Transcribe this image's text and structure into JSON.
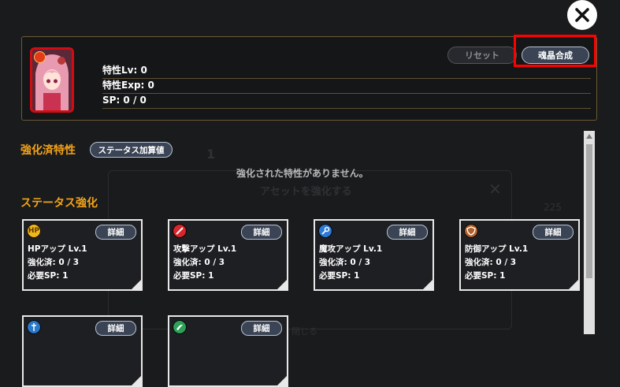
{
  "background_ghost": {
    "title": "アセットを強化する",
    "value": "225",
    "close_label": "閉じる",
    "count": "1"
  },
  "header": {
    "trait_level": "特性Lv: 0",
    "trait_exp": "特性Exp: 0",
    "sp": "SP: 0 / 0",
    "reset_label": "リセット",
    "synth_label": "魂晶合成"
  },
  "enhanced": {
    "title": "強化済特性",
    "status_button": "ステータス加算値",
    "empty_message": "強化された特性がありません。"
  },
  "status_section": {
    "title": "ステータス強化",
    "detail_label": "詳細",
    "cards": [
      {
        "icon_name": "hp-icon",
        "icon_text": "HP",
        "name": "HPアップ Lv.1",
        "level": "強化済: 0 / 3",
        "sp": "必要SP: 1",
        "color": "#f2b51a"
      },
      {
        "icon_name": "sword-icon",
        "icon_text": "",
        "name": "攻撃アップ Lv.1",
        "level": "強化済: 0 / 3",
        "sp": "必要SP: 1",
        "color": "#d8262d"
      },
      {
        "icon_name": "magic-staff-icon",
        "icon_text": "",
        "name": "魔攻アップ Lv.1",
        "level": "強化済: 0 / 3",
        "sp": "必要SP: 1",
        "color": "#2d79d6"
      },
      {
        "icon_name": "shield-icon",
        "icon_text": "",
        "name": "防御アップ Lv.1",
        "level": "強化済: 0 / 3",
        "sp": "必要SP: 1",
        "color": "#b0602b"
      },
      {
        "icon_name": "magic-defense-icon",
        "icon_text": "",
        "name": "",
        "level": "",
        "sp": "",
        "color": "#2a78c8"
      },
      {
        "icon_name": "speed-icon",
        "icon_text": "",
        "name": "",
        "level": "",
        "sp": "",
        "color": "#2fa05a"
      }
    ]
  }
}
